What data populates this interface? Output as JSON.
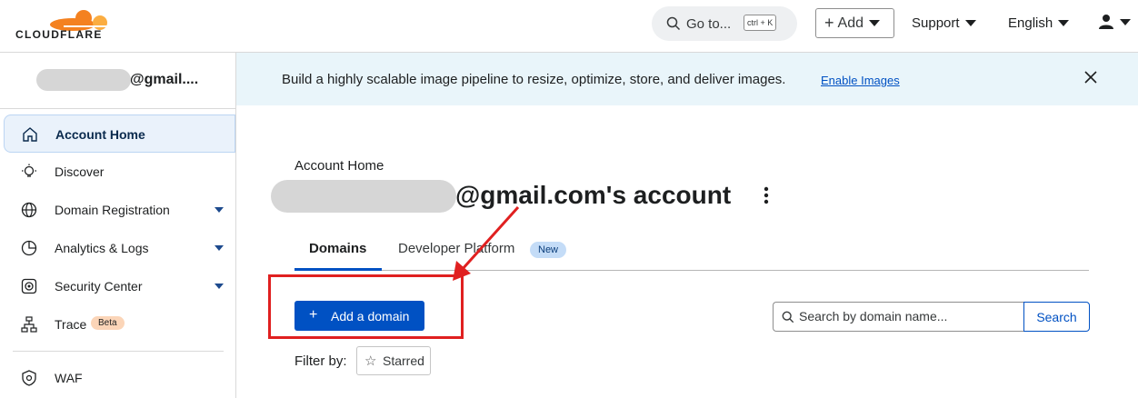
{
  "topbar": {
    "logo_text": "CLOUDFLARE",
    "goto_label": "Go to...",
    "goto_shortcut": "ctrl + K",
    "add_label": "Add",
    "support_label": "Support",
    "language_label": "English",
    "icons": [
      "search-icon",
      "plus-icon",
      "user-icon"
    ]
  },
  "sidebar": {
    "account_name": "@gmail....",
    "items": [
      {
        "label": "Account Home",
        "icon": "home-icon",
        "active": true
      },
      {
        "label": "Discover",
        "icon": "lightbulb-icon"
      },
      {
        "label": "Domain Registration",
        "icon": "globe-icon",
        "dropdown": true
      },
      {
        "label": "Analytics & Logs",
        "icon": "pie-chart-icon",
        "dropdown": true
      },
      {
        "label": "Security Center",
        "icon": "security-icon",
        "dropdown": true
      },
      {
        "label": "Trace",
        "icon": "tree-icon",
        "badge": "Beta"
      },
      {
        "label": "WAF",
        "icon": "shield-gear-icon"
      }
    ]
  },
  "banner": {
    "text": "Build a highly scalable image pipeline to resize, optimize, store, and deliver images.",
    "link": "Enable Images"
  },
  "main": {
    "breadcrumb": "Account Home",
    "account_title": "@gmail.com's account",
    "tabs": [
      {
        "label": "Domains",
        "active": true
      },
      {
        "label": "Developer Platform",
        "badge": "New"
      }
    ],
    "add_domain_label": "Add a domain",
    "search_placeholder": "Search by domain name...",
    "search_button": "Search",
    "filter_label": "Filter by:",
    "filter_starred": "Starred"
  },
  "colors": {
    "accent": "#0051c3",
    "banner_bg": "#e9f5fa",
    "annotation_red": "#e02020",
    "logo_orange": "#f48120"
  }
}
